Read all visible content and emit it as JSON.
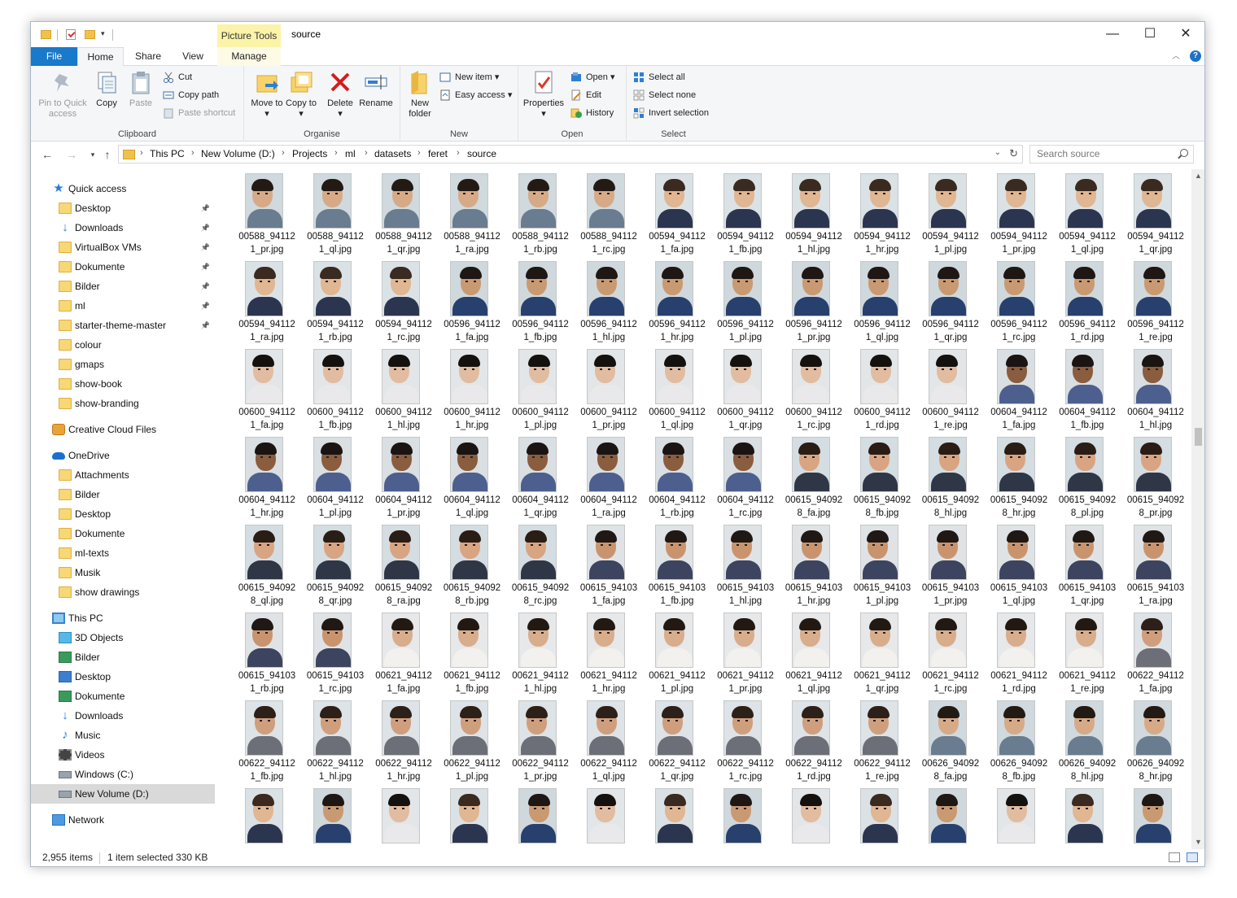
{
  "window": {
    "title": "source",
    "contextual_tab": "Picture Tools",
    "controls": {
      "minimize": "—",
      "maximize": "☐",
      "close": "✕"
    }
  },
  "ribbon": {
    "tabs": [
      {
        "label": "File"
      },
      {
        "label": "Home"
      },
      {
        "label": "Share"
      },
      {
        "label": "View"
      },
      {
        "label": "Manage"
      }
    ],
    "clipboard": {
      "group": "Clipboard",
      "pin": "Pin to Quick access",
      "copy": "Copy",
      "paste": "Paste",
      "cut": "Cut",
      "copy_path": "Copy path",
      "paste_shortcut": "Paste shortcut"
    },
    "organise": {
      "group": "Organise",
      "move_to": "Move to",
      "copy_to": "Copy to",
      "delete": "Delete",
      "rename": "Rename"
    },
    "new": {
      "group": "New",
      "new_folder": "New folder",
      "new_item": "New item",
      "easy_access": "Easy access"
    },
    "open": {
      "group": "Open",
      "properties": "Properties",
      "open": "Open",
      "edit": "Edit",
      "history": "History"
    },
    "select": {
      "group": "Select",
      "select_all": "Select all",
      "select_none": "Select none",
      "invert": "Invert selection"
    }
  },
  "address": {
    "crumbs": [
      "This PC",
      "New Volume (D:)",
      "Projects",
      "ml",
      "datasets",
      "feret",
      "source"
    ],
    "search_placeholder": "Search source"
  },
  "nav_pane": {
    "items": [
      {
        "label": "Quick access",
        "icon": "star-icon",
        "level": 0
      },
      {
        "label": "Desktop",
        "icon": "folder-icon",
        "level": 1,
        "pinned": true
      },
      {
        "label": "Downloads",
        "icon": "download-arrow-icon",
        "level": 1,
        "pinned": true
      },
      {
        "label": "VirtualBox VMs",
        "icon": "folder-icon",
        "level": 1,
        "pinned": true
      },
      {
        "label": "Dokumente",
        "icon": "folder-icon",
        "level": 1,
        "pinned": true
      },
      {
        "label": "Bilder",
        "icon": "folder-icon",
        "level": 1,
        "pinned": true
      },
      {
        "label": "ml",
        "icon": "folder-icon",
        "level": 1,
        "pinned": true
      },
      {
        "label": "starter-theme-master",
        "icon": "folder-icon",
        "level": 1,
        "pinned": true
      },
      {
        "label": "colour",
        "icon": "folder-icon",
        "level": 1
      },
      {
        "label": "gmaps",
        "icon": "folder-icon",
        "level": 1
      },
      {
        "label": "show-book",
        "icon": "folder-icon",
        "level": 1
      },
      {
        "label": "show-branding",
        "icon": "folder-icon",
        "level": 1
      },
      {
        "label": "Creative Cloud Files",
        "icon": "creative-cloud-icon",
        "level": 0
      },
      {
        "label": "OneDrive",
        "icon": "cloud-icon",
        "level": 0
      },
      {
        "label": "Attachments",
        "icon": "folder-icon",
        "level": 1
      },
      {
        "label": "Bilder",
        "icon": "folder-icon",
        "level": 1
      },
      {
        "label": "Desktop",
        "icon": "folder-icon",
        "level": 1
      },
      {
        "label": "Dokumente",
        "icon": "folder-icon",
        "level": 1
      },
      {
        "label": "ml-texts",
        "icon": "folder-icon",
        "level": 1
      },
      {
        "label": "Musik",
        "icon": "folder-icon",
        "level": 1
      },
      {
        "label": "show drawings",
        "icon": "folder-icon",
        "level": 1
      },
      {
        "label": "This PC",
        "icon": "computer-icon",
        "level": 0
      },
      {
        "label": "3D Objects",
        "icon": "3d-objects-icon",
        "level": 1
      },
      {
        "label": "Bilder",
        "icon": "pictures-icon",
        "level": 1
      },
      {
        "label": "Desktop",
        "icon": "desktop-icon",
        "level": 1
      },
      {
        "label": "Dokumente",
        "icon": "documents-icon",
        "level": 1
      },
      {
        "label": "Downloads",
        "icon": "download-arrow-icon",
        "level": 1
      },
      {
        "label": "Music",
        "icon": "music-note-icon",
        "level": 1
      },
      {
        "label": "Videos",
        "icon": "video-icon",
        "level": 1
      },
      {
        "label": "Windows (C:)",
        "icon": "drive-icon",
        "level": 1
      },
      {
        "label": "New Volume (D:)",
        "icon": "drive-icon",
        "level": 1,
        "selected": true
      },
      {
        "label": "Network",
        "icon": "network-icon",
        "level": 0
      }
    ]
  },
  "files": [
    [
      "00588_94112",
      "1_pr.jpg"
    ],
    [
      "00588_94112",
      "1_ql.jpg"
    ],
    [
      "00588_94112",
      "1_qr.jpg"
    ],
    [
      "00588_94112",
      "1_ra.jpg"
    ],
    [
      "00588_94112",
      "1_rb.jpg"
    ],
    [
      "00588_94112",
      "1_rc.jpg"
    ],
    [
      "00594_94112",
      "1_fa.jpg"
    ],
    [
      "00594_94112",
      "1_fb.jpg"
    ],
    [
      "00594_94112",
      "1_hl.jpg"
    ],
    [
      "00594_94112",
      "1_hr.jpg"
    ],
    [
      "00594_94112",
      "1_pl.jpg"
    ],
    [
      "00594_94112",
      "1_pr.jpg"
    ],
    [
      "00594_94112",
      "1_ql.jpg"
    ],
    [
      "00594_94112",
      "1_qr.jpg"
    ],
    [
      "00594_94112",
      "1_ra.jpg"
    ],
    [
      "00594_94112",
      "1_rb.jpg"
    ],
    [
      "00594_94112",
      "1_rc.jpg"
    ],
    [
      "00596_94112",
      "1_fa.jpg"
    ],
    [
      "00596_94112",
      "1_fb.jpg"
    ],
    [
      "00596_94112",
      "1_hl.jpg"
    ],
    [
      "00596_94112",
      "1_hr.jpg"
    ],
    [
      "00596_94112",
      "1_pl.jpg"
    ],
    [
      "00596_94112",
      "1_pr.jpg"
    ],
    [
      "00596_94112",
      "1_ql.jpg"
    ],
    [
      "00596_94112",
      "1_qr.jpg"
    ],
    [
      "00596_94112",
      "1_rc.jpg"
    ],
    [
      "00596_94112",
      "1_rd.jpg"
    ],
    [
      "00596_94112",
      "1_re.jpg"
    ],
    [
      "00600_94112",
      "1_fa.jpg"
    ],
    [
      "00600_94112",
      "1_fb.jpg"
    ],
    [
      "00600_94112",
      "1_hl.jpg"
    ],
    [
      "00600_94112",
      "1_hr.jpg"
    ],
    [
      "00600_94112",
      "1_pl.jpg"
    ],
    [
      "00600_94112",
      "1_pr.jpg"
    ],
    [
      "00600_94112",
      "1_ql.jpg"
    ],
    [
      "00600_94112",
      "1_qr.jpg"
    ],
    [
      "00600_94112",
      "1_rc.jpg"
    ],
    [
      "00600_94112",
      "1_rd.jpg"
    ],
    [
      "00600_94112",
      "1_re.jpg"
    ],
    [
      "00604_94112",
      "1_fa.jpg"
    ],
    [
      "00604_94112",
      "1_fb.jpg"
    ],
    [
      "00604_94112",
      "1_hl.jpg"
    ],
    [
      "00604_94112",
      "1_hr.jpg"
    ],
    [
      "00604_94112",
      "1_pl.jpg"
    ],
    [
      "00604_94112",
      "1_pr.jpg"
    ],
    [
      "00604_94112",
      "1_ql.jpg"
    ],
    [
      "00604_94112",
      "1_qr.jpg"
    ],
    [
      "00604_94112",
      "1_ra.jpg"
    ],
    [
      "00604_94112",
      "1_rb.jpg"
    ],
    [
      "00604_94112",
      "1_rc.jpg"
    ],
    [
      "00615_94092",
      "8_fa.jpg"
    ],
    [
      "00615_94092",
      "8_fb.jpg"
    ],
    [
      "00615_94092",
      "8_hl.jpg"
    ],
    [
      "00615_94092",
      "8_hr.jpg"
    ],
    [
      "00615_94092",
      "8_pl.jpg"
    ],
    [
      "00615_94092",
      "8_pr.jpg"
    ],
    [
      "00615_94092",
      "8_ql.jpg"
    ],
    [
      "00615_94092",
      "8_qr.jpg"
    ],
    [
      "00615_94092",
      "8_ra.jpg"
    ],
    [
      "00615_94092",
      "8_rb.jpg"
    ],
    [
      "00615_94092",
      "8_rc.jpg"
    ],
    [
      "00615_94103",
      "1_fa.jpg"
    ],
    [
      "00615_94103",
      "1_fb.jpg"
    ],
    [
      "00615_94103",
      "1_hl.jpg"
    ],
    [
      "00615_94103",
      "1_hr.jpg"
    ],
    [
      "00615_94103",
      "1_pl.jpg"
    ],
    [
      "00615_94103",
      "1_pr.jpg"
    ],
    [
      "00615_94103",
      "1_ql.jpg"
    ],
    [
      "00615_94103",
      "1_qr.jpg"
    ],
    [
      "00615_94103",
      "1_ra.jpg"
    ],
    [
      "00615_94103",
      "1_rb.jpg"
    ],
    [
      "00615_94103",
      "1_rc.jpg"
    ],
    [
      "00621_94112",
      "1_fa.jpg"
    ],
    [
      "00621_94112",
      "1_fb.jpg"
    ],
    [
      "00621_94112",
      "1_hl.jpg"
    ],
    [
      "00621_94112",
      "1_hr.jpg"
    ],
    [
      "00621_94112",
      "1_pl.jpg"
    ],
    [
      "00621_94112",
      "1_pr.jpg"
    ],
    [
      "00621_94112",
      "1_ql.jpg"
    ],
    [
      "00621_94112",
      "1_qr.jpg"
    ],
    [
      "00621_94112",
      "1_rc.jpg"
    ],
    [
      "00621_94112",
      "1_rd.jpg"
    ],
    [
      "00621_94112",
      "1_re.jpg"
    ],
    [
      "00622_94112",
      "1_fa.jpg"
    ],
    [
      "00622_94112",
      "1_fb.jpg"
    ],
    [
      "00622_94112",
      "1_hl.jpg"
    ],
    [
      "00622_94112",
      "1_hr.jpg"
    ],
    [
      "00622_94112",
      "1_pl.jpg"
    ],
    [
      "00622_94112",
      "1_pr.jpg"
    ],
    [
      "00622_94112",
      "1_ql.jpg"
    ],
    [
      "00622_94112",
      "1_qr.jpg"
    ],
    [
      "00622_94112",
      "1_rc.jpg"
    ],
    [
      "00622_94112",
      "1_rd.jpg"
    ],
    [
      "00622_94112",
      "1_re.jpg"
    ],
    [
      "00626_94092",
      "8_fa.jpg"
    ],
    [
      "00626_94092",
      "8_fb.jpg"
    ],
    [
      "00626_94092",
      "8_hl.jpg"
    ],
    [
      "00626_94092",
      "8_hr.jpg"
    ]
  ],
  "partial_row_count": 14,
  "status": {
    "item_count": "2,955 items",
    "selection": "1 item selected  330 KB"
  },
  "colors": {
    "file_tab": "#1979ca",
    "picture_tools": "#fbf3a8",
    "selected_nav": "#d9d9d9"
  }
}
